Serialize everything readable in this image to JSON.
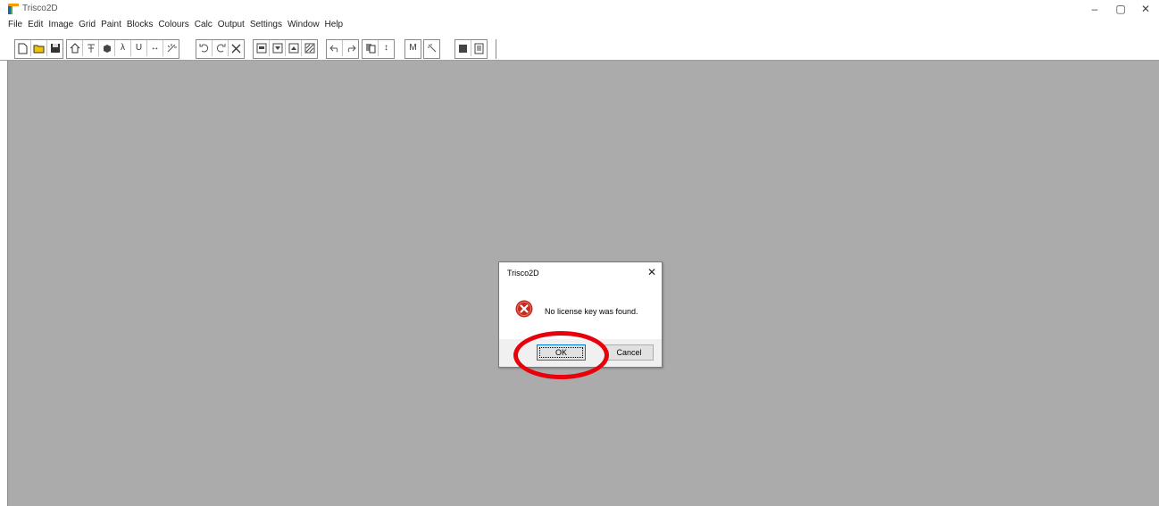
{
  "window": {
    "title": "Trisco2D",
    "controls": {
      "minimize": "–",
      "restore": "▢",
      "close": "✕"
    }
  },
  "menu": [
    "File",
    "Edit",
    "Image",
    "Grid",
    "Paint",
    "Blocks",
    "Colours",
    "Calc",
    "Output",
    "Settings",
    "Window",
    "Help"
  ],
  "toolbar": {
    "text_buttons": {
      "lambda": "λ",
      "u": "U",
      "arrows": "↔",
      "swap": "↕",
      "m": "M"
    }
  },
  "dialog": {
    "title": "Trisco2D",
    "close": "✕",
    "message": "No license key was found.",
    "ok_label": "OK",
    "cancel_label": "Cancel"
  },
  "colors": {
    "workspace": "#ababab",
    "error_icon": "#c42b1c",
    "highlight_ring": "#e8000b"
  }
}
